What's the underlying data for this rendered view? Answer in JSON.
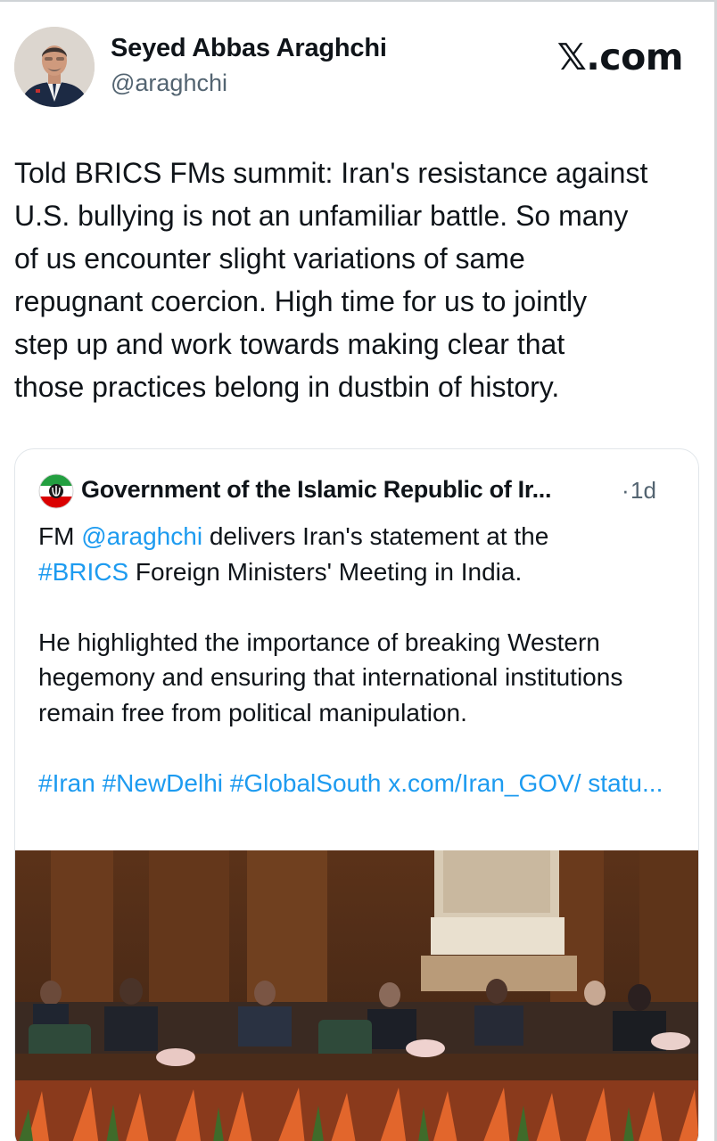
{
  "author": {
    "name": "Seyed Abbas Araghchi",
    "handle": "@araghchi",
    "avatar_icon": "profile-photo"
  },
  "brand": {
    "label": "𝕏.com"
  },
  "tweet": {
    "text": "Told BRICS FMs summit: Iran's resistance against\nU.S. bullying is not an unfamiliar battle. So many\nof us encounter slight variations of same\nrepugnant coercion. High time for us to jointly\nstep up and work towards making clear that\nthose practices belong in dustbin of history."
  },
  "quote": {
    "author_name": "Government of the Islamic Republic of Ir...",
    "separator": "·",
    "time": "1d",
    "avatar_icon": "iran-emblem-icon",
    "line1_prefix": "FM ",
    "line1_mention": "@araghchi",
    "line1_suffix": " delivers Iran's statement at the",
    "line2_hashtag": "#BRICS",
    "line2_suffix": " Foreign Ministers' Meeting in India.",
    "para2": "He highlighted the importance of breaking Western hegemony and ensuring that international institutions remain free from political manipulation.",
    "tags": "#Iran #NewDelhi #GlobalSouth x.com/Iran_GOV/ statu...",
    "media_icon": "meeting-photo"
  },
  "colors": {
    "link": "#1d9bf0",
    "text": "#0f1419",
    "secondary": "#536471",
    "border": "#e1e6ea"
  }
}
